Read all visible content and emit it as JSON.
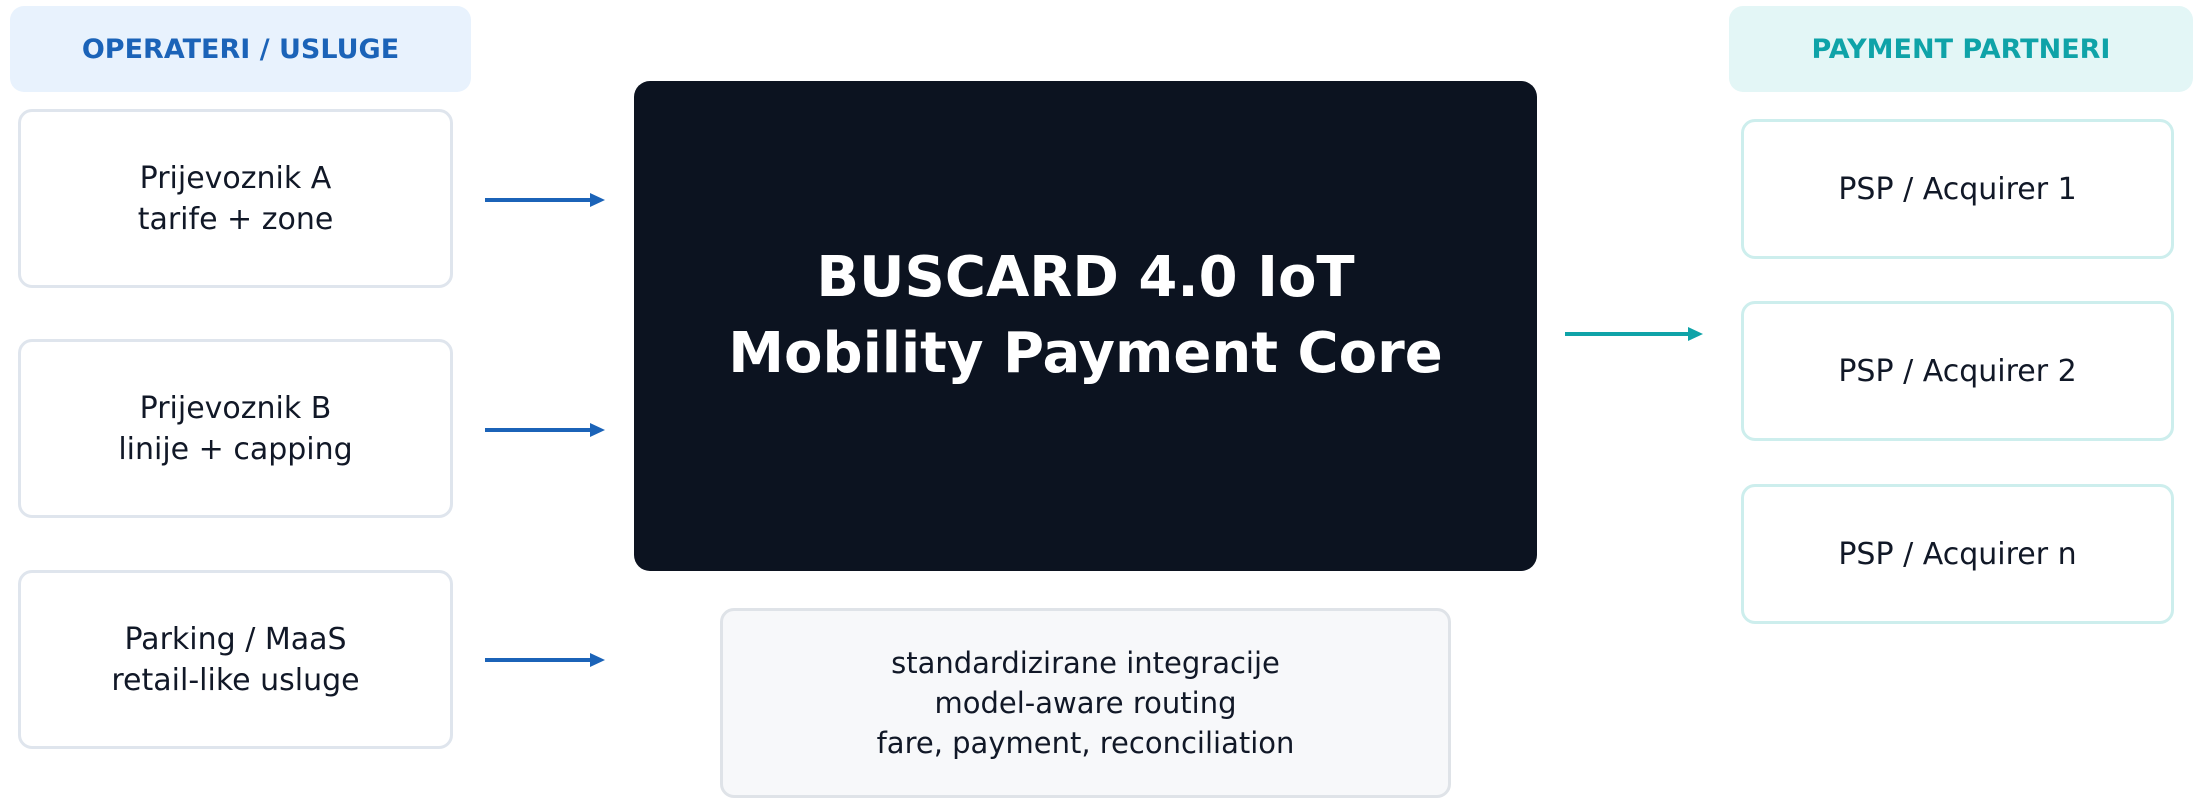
{
  "left_group": {
    "header": "OPERATERI / USLUGE",
    "items": [
      {
        "line1": "Prijevoznik A",
        "line2": "tarife + zone"
      },
      {
        "line1": "Prijevoznik B",
        "line2": "linije + capping"
      },
      {
        "line1": "Parking / MaaS",
        "line2": "retail-like usluge"
      }
    ]
  },
  "core": {
    "line1": "BUSCARD 4.0 IoT",
    "line2": "Mobility Payment Core"
  },
  "features": {
    "lines": [
      "standardizirane integracije",
      "model-aware routing",
      "fare, payment, reconciliation"
    ]
  },
  "right_group": {
    "header": "PAYMENT PARTNERI",
    "items": [
      "PSP / Acquirer 1",
      "PSP / Acquirer 2",
      "PSP / Acquirer n"
    ]
  },
  "colors": {
    "blue_accent": "#1b63b8",
    "teal_accent": "#0fa3a8",
    "core_background": "#0c1320"
  }
}
